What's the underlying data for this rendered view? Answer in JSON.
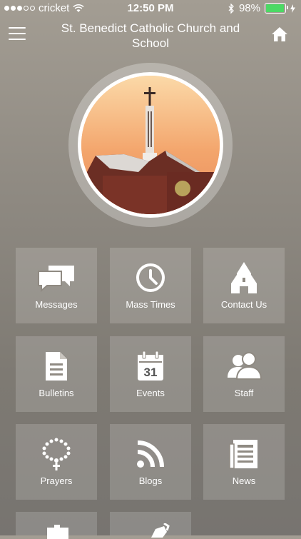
{
  "status": {
    "carrier": "cricket",
    "time": "12:50 PM",
    "battery": "98%",
    "battery_level": 0.98,
    "battery_color": "#4cd964"
  },
  "header": {
    "title": "St. Benedict Catholic Church and School",
    "menu_icon": "hamburger-icon",
    "home_icon": "home-icon"
  },
  "tiles": [
    {
      "label": "Messages",
      "icon": "messages-icon"
    },
    {
      "label": "Mass Times",
      "icon": "clock-icon"
    },
    {
      "label": "Contact Us",
      "icon": "church-icon"
    },
    {
      "label": "Bulletins",
      "icon": "document-icon"
    },
    {
      "label": "Events",
      "icon": "calendar-icon",
      "icon_text": "31"
    },
    {
      "label": "Staff",
      "icon": "people-icon"
    },
    {
      "label": "Prayers",
      "icon": "rosary-icon"
    },
    {
      "label": "Blogs",
      "icon": "rss-icon"
    },
    {
      "label": "News",
      "icon": "newspaper-icon"
    }
  ]
}
